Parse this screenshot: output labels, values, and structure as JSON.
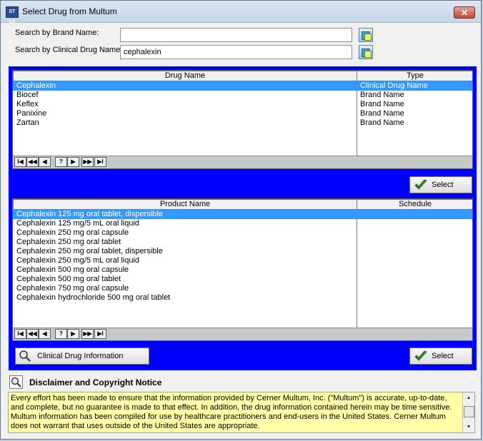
{
  "window": {
    "title": "Select Drug from Multum",
    "icon_label": "ST LX",
    "close_label": "✕"
  },
  "search": {
    "brand_label": "Search by Brand Name:",
    "brand_value": "",
    "clinical_label": "Search by Clinical Drug Name:",
    "clinical_value": "cephalexin"
  },
  "drug_grid": {
    "columns": [
      "Drug Name",
      "Type"
    ],
    "rows": [
      {
        "name": "Cephalexin",
        "type": "Clinical Drug Name",
        "selected": true
      },
      {
        "name": "Biocef",
        "type": "Brand Name"
      },
      {
        "name": "Keflex",
        "type": "Brand Name"
      },
      {
        "name": "Panixine",
        "type": "Brand Name"
      },
      {
        "name": "Zartan",
        "type": "Brand Name"
      }
    ]
  },
  "nav_buttons": [
    "I◀",
    "◀◀",
    "◀",
    "?",
    "▶",
    "▶▶",
    "▶I"
  ],
  "select_label": "Select",
  "product_grid": {
    "columns": [
      "Product Name",
      "Schedule"
    ],
    "rows": [
      {
        "name": "Cephalexin 125 mg oral tablet, dispersible",
        "schedule": "",
        "selected": true
      },
      {
        "name": "Cephalexin 125 mg/5 mL oral liquid",
        "schedule": ""
      },
      {
        "name": "Cephalexin 250 mg oral capsule",
        "schedule": ""
      },
      {
        "name": "Cephalexin 250 mg oral tablet",
        "schedule": ""
      },
      {
        "name": "Cephalexin 250 mg oral tablet, dispersible",
        "schedule": ""
      },
      {
        "name": "Cephalexin 250 mg/5 mL oral liquid",
        "schedule": ""
      },
      {
        "name": "Cephalexin 500 mg oral capsule",
        "schedule": ""
      },
      {
        "name": "Cephalexin 500 mg oral tablet",
        "schedule": ""
      },
      {
        "name": "Cephalexin 750 mg oral capsule",
        "schedule": ""
      },
      {
        "name": "Cephalexin hydrochloride 500 mg oral tablet",
        "schedule": ""
      }
    ]
  },
  "clinical_info_label": "Clinical Drug Information",
  "disclaimer": {
    "title": "Disclaimer and Copyright Notice",
    "text": "Every effort has been made to ensure that the information provided by Cerner Multum, Inc. (\"Multum\") is accurate, up-to-date, and complete, but no guarantee is made to that effect. In addition, the drug information contained herein may be time sensitive. Multum information has been compiled for use by healthcare practitioners and end-users in the United States. Cerner Multum does not warrant that uses outside of the United States are appropriate."
  },
  "colors": {
    "panel_blue": "#0000ff",
    "selection": "#3399ff",
    "disclaimer_bg": "#ffffa8"
  }
}
